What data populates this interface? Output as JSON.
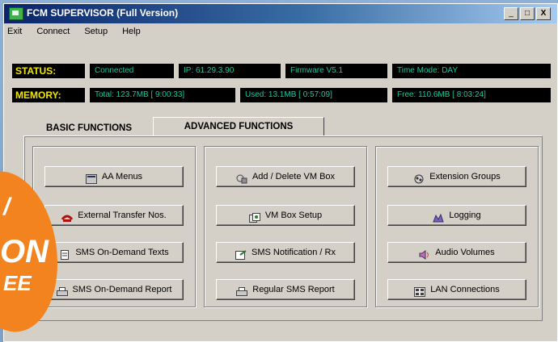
{
  "window": {
    "title": "FCM SUPERVISOR (Full Version)",
    "controls": [
      "_",
      "□",
      "X"
    ]
  },
  "menubar": [
    "Exit",
    "Connect",
    "Setup",
    "Help"
  ],
  "status": {
    "label": "STATUS:",
    "connection": "Connected",
    "ip": "IP: 61.29.3.90",
    "firmware": "Firmware V5.1",
    "time_mode": "Time Mode: DAY"
  },
  "memory": {
    "label": "MEMORY:",
    "total": "Total: 123.7MB [ 9:00:33]",
    "used": "Used: 13.1MB [ 0:57:09]",
    "free": "Free: 110.6MB [ 8:03:24]"
  },
  "tabs": {
    "basic": "BASIC FUNCTIONS",
    "advanced": "ADVANCED FUNCTIONS",
    "active": "advanced"
  },
  "buttons": {
    "col1": [
      "AA Menus",
      "External Transfer Nos.",
      "SMS On-Demand Texts",
      "SMS On-Demand Report"
    ],
    "col2": [
      "Add / Delete VM Box",
      "VM Box Setup",
      "SMS Notification / Rx",
      "Regular SMS Report"
    ],
    "col3": [
      "Extension Groups",
      "Logging",
      "Audio Volumes",
      "LAN Connections"
    ]
  },
  "promo": {
    "line1": "/",
    "line2": "ON",
    "line3": "EE"
  },
  "colors": {
    "status_label": "#f3e600",
    "status_value": "#16c9a0",
    "promo": "#f2831e"
  },
  "icons": {
    "col1": [
      "menu-icon",
      "transfer-icon",
      "document-icon",
      "printer-icon"
    ],
    "col2": [
      "vm-box-icon",
      "setup-icon",
      "sms-icon",
      "printer-icon"
    ],
    "col3": [
      "groups-icon",
      "logging-icon",
      "speaker-icon",
      "lan-icon"
    ]
  }
}
